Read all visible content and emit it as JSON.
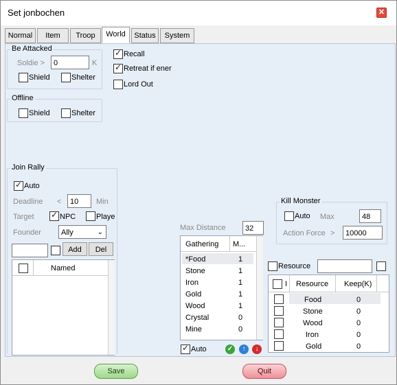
{
  "window": {
    "title": "Set jonbochen"
  },
  "tabs": [
    "Normal",
    "Item",
    "Troop",
    "World",
    "Status",
    "System"
  ],
  "be_attacked": {
    "title": "Be Attacked",
    "soldier_label": "Soldie >",
    "soldier_value": "0",
    "soldier_unit": "K",
    "shield": "Shield",
    "shelter": "Shelter"
  },
  "options": {
    "recall": "Recall",
    "retreat": "Retreat if ener",
    "lord_out": "Lord Out"
  },
  "offline": {
    "title": "Offline",
    "shield": "Shield",
    "shelter": "Shelter"
  },
  "join_rally": {
    "title": "Join Rally",
    "auto": "Auto",
    "deadline_label": "Deadline",
    "deadline_op": "<",
    "deadline_value": "10",
    "deadline_unit": "Min",
    "target_label": "Target",
    "npc": "NPC",
    "player": "Playe",
    "founder_label": "Founder",
    "founder_value": "Ally",
    "add": "Add",
    "del": "Del",
    "list_header": "Named"
  },
  "kill_monster": {
    "title": "Kill Monster",
    "auto": "Auto",
    "max_label": "Max",
    "max_value": "48",
    "action_label": "Action Force",
    "action_op": ">",
    "action_value": "10000"
  },
  "gathering": {
    "max_distance_label": "Max Distance",
    "max_distance_value": "32",
    "col_gathering": "Gathering",
    "col_m": "M...",
    "rows": [
      {
        "name": "*Food",
        "val": "1"
      },
      {
        "name": "Stone",
        "val": "1"
      },
      {
        "name": "Iron",
        "val": "1"
      },
      {
        "name": "Gold",
        "val": "1"
      },
      {
        "name": "Wood",
        "val": "1"
      },
      {
        "name": "Crystal",
        "val": "0"
      },
      {
        "name": "Mine",
        "val": "0"
      }
    ],
    "auto": "Auto"
  },
  "resource": {
    "label": "Resource",
    "col_i": "I",
    "col_resource": "Resource",
    "col_keep": "Keep(K)",
    "rows": [
      {
        "name": "Food",
        "keep": "0"
      },
      {
        "name": "Stone",
        "keep": "0"
      },
      {
        "name": "Wood",
        "keep": "0"
      },
      {
        "name": "Iron",
        "keep": "0"
      },
      {
        "name": "Gold",
        "keep": "0"
      }
    ]
  },
  "footer": {
    "save": "Save",
    "quit": "Quit"
  },
  "colors": {
    "save": "#9ed88a",
    "quit": "#ee8f99",
    "check_green": "#3aa53a",
    "arrow_blue": "#2f7fd6",
    "arrow_red": "#d42a2a"
  }
}
